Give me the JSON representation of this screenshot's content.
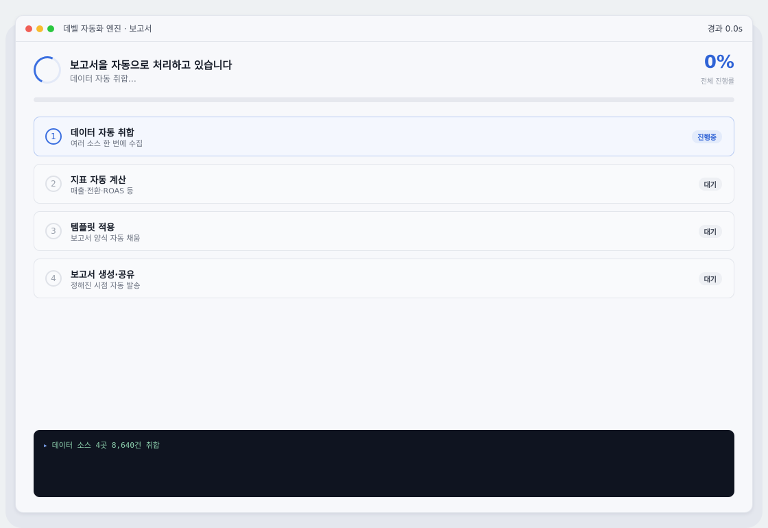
{
  "window": {
    "title": "데벨 자동화 엔진 · 보고서",
    "elapsed": "경과 0.0s",
    "dots": [
      "#f05f57",
      "#f8bc2f",
      "#2ac73f"
    ]
  },
  "header": {
    "title": "보고서을 자동으로 처리하고 있습니다",
    "subtitle": "데이터 자동 취합…",
    "percent": "0%",
    "percent_label": "전체 진행률"
  },
  "progress": {
    "value": 0
  },
  "steps": [
    {
      "num": "1",
      "title": "데이터 자동 취합",
      "desc": "여러 소스 한 번에 수집",
      "status": "진행중",
      "active": true
    },
    {
      "num": "2",
      "title": "지표 자동 계산",
      "desc": "매출·전환·ROAS 등",
      "status": "대기",
      "active": false
    },
    {
      "num": "3",
      "title": "템플릿 적용",
      "desc": "보고서 양식 자동 채움",
      "status": "대기",
      "active": false
    },
    {
      "num": "4",
      "title": "보고서 생성·공유",
      "desc": "정해진 시점 자동 발송",
      "status": "대기",
      "active": false
    }
  ],
  "console": {
    "lines": [
      {
        "prefix": "▸",
        "text": "데이터 소스 4곳 8,640건 취합"
      }
    ]
  },
  "colors": {
    "accent": "#2f63d6",
    "console_bg": "#0f1420",
    "log_text": "#8fd3b0"
  }
}
